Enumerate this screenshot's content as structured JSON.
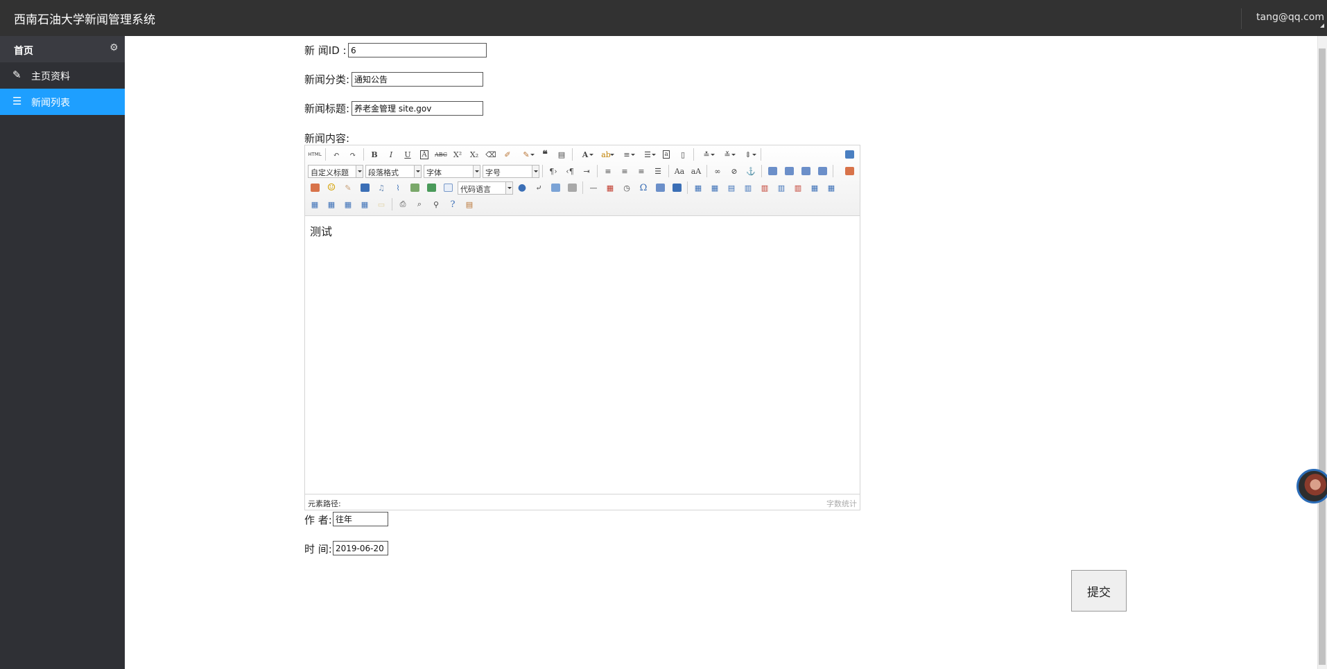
{
  "header": {
    "title": "西南石油大学新闻管理系统",
    "user": "tang@qq.com"
  },
  "sidebar": {
    "head": {
      "label": "首页",
      "icon": "gear-icon"
    },
    "items": [
      {
        "label": "主页资料",
        "icon": "pencil-icon",
        "active": false
      },
      {
        "label": "新闻列表",
        "icon": "list-icon",
        "active": true
      }
    ]
  },
  "form": {
    "news_id": {
      "label": "新 闻ID :",
      "value": "6"
    },
    "category": {
      "label": "新闻分类:",
      "value": "通知公告"
    },
    "title": {
      "label": "新闻标题:",
      "value": "养老金管理 site.gov"
    },
    "content": {
      "label": "新闻内容:"
    },
    "author": {
      "label": "作 者:",
      "value": "往年"
    },
    "time": {
      "label": "时 间:",
      "value": "2019-06-20"
    },
    "submit_label": "提交"
  },
  "editor": {
    "html_label": "HTML",
    "selects": {
      "custom_heading": "自定义标题",
      "paragraph": "段落格式",
      "font": "字体",
      "size": "字号",
      "code_lang": "代码语言"
    },
    "content": "测试",
    "status_path": "元素路径:",
    "word_count": "字数统计"
  },
  "colors": {
    "topbar": "#323232",
    "sidebar": "#2f3035",
    "active": "#1e9fff"
  }
}
